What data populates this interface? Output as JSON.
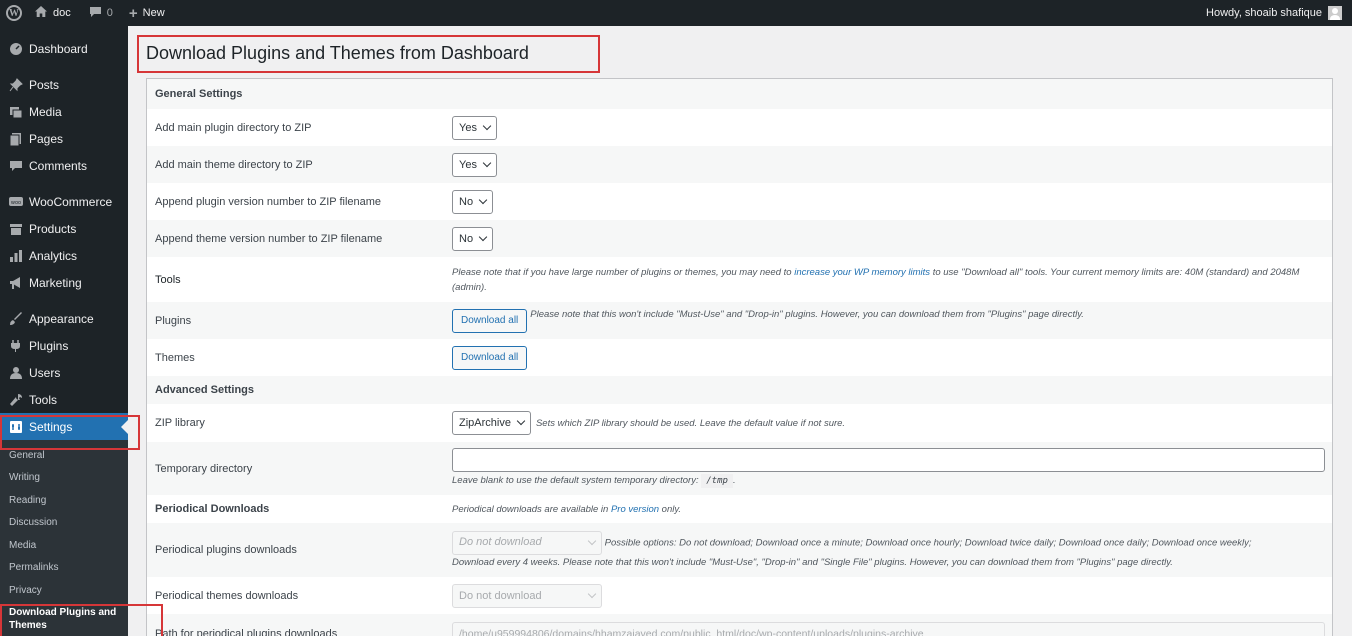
{
  "adminbar": {
    "site_name": "doc",
    "comments_count": "0",
    "new_label": "New",
    "howdy": "Howdy, shoaib shafique"
  },
  "sidebar": {
    "items": [
      {
        "label": "Dashboard",
        "icon": "dashboard-icon"
      },
      {
        "label": "Posts",
        "icon": "pin-icon"
      },
      {
        "label": "Media",
        "icon": "media-icon"
      },
      {
        "label": "Pages",
        "icon": "pages-icon"
      },
      {
        "label": "Comments",
        "icon": "comment-icon"
      },
      {
        "label": "WooCommerce",
        "icon": "woo-icon"
      },
      {
        "label": "Products",
        "icon": "archive-icon"
      },
      {
        "label": "Analytics",
        "icon": "chart-icon"
      },
      {
        "label": "Marketing",
        "icon": "megaphone-icon"
      },
      {
        "label": "Appearance",
        "icon": "brush-icon"
      },
      {
        "label": "Plugins",
        "icon": "plug-icon"
      },
      {
        "label": "Users",
        "icon": "user-icon"
      },
      {
        "label": "Tools",
        "icon": "wrench-icon"
      },
      {
        "label": "Settings",
        "icon": "settings-icon"
      }
    ],
    "settings_sub": [
      "General",
      "Writing",
      "Reading",
      "Discussion",
      "Media",
      "Permalinks",
      "Privacy",
      "Download Plugins and Themes"
    ]
  },
  "page": {
    "title": "Download Plugins and Themes from Dashboard"
  },
  "settings": {
    "general_heading": "General Settings",
    "main_plugin_dir_label": "Add main plugin directory to ZIP",
    "main_plugin_dir_value": "Yes",
    "main_theme_dir_label": "Add main theme directory to ZIP",
    "main_theme_dir_value": "Yes",
    "plugin_version_label": "Append plugin version number to ZIP filename",
    "plugin_version_value": "No",
    "theme_version_label": "Append theme version number to ZIP filename",
    "theme_version_value": "No",
    "tools_heading": "Tools",
    "tools_note_pre": "Please note that if you have large number of plugins or themes, you may need to ",
    "tools_note_link": "increase your WP memory limits",
    "tools_note_post": " to use \"Download all\" tools. Your current memory limits are: 40M (standard) and 2048M (admin).",
    "plugins_label": "Plugins",
    "download_all_label": "Download all",
    "plugins_note": "Please note that this won't include \"Must-Use\" and \"Drop-in\" plugins. However, you can download them from \"Plugins\" page directly.",
    "themes_label": "Themes",
    "advanced_heading": "Advanced Settings",
    "zip_library_label": "ZIP library",
    "zip_library_value": "ZipArchive",
    "zip_library_note": "Sets which ZIP library should be used. Leave the default value if not sure.",
    "temp_dir_label": "Temporary directory",
    "temp_dir_value": "",
    "temp_dir_note_pre": "Leave blank to use the default system temporary directory: ",
    "temp_dir_code": "/tmp",
    "temp_dir_note_post": ".",
    "periodical_heading": "Periodical Downloads",
    "periodical_note_pre": "Periodical downloads are available in ",
    "periodical_note_link": "Pro version",
    "periodical_note_post": " only.",
    "periodical_plugins_label": "Periodical plugins downloads",
    "periodical_plugins_value": "Do not download",
    "periodical_plugins_note_line1": "Possible options: Do not download; Download once a minute; Download once hourly; Download twice daily; Download once daily; Download once weekly;",
    "periodical_plugins_note_line2": "Download every 4 weeks. Please note that this won't include \"Must-Use\", \"Drop-in\" and \"Single File\" plugins. However, you can download them from \"Plugins\" page directly.",
    "periodical_themes_label": "Periodical themes downloads",
    "periodical_themes_value": "Do not download",
    "periodical_path_label": "Path for periodical plugins downloads",
    "periodical_path_value": "/home/u959994806/domains/hhamzajaved.com/public_html/doc/wp-content/uploads/plugins-archive"
  }
}
